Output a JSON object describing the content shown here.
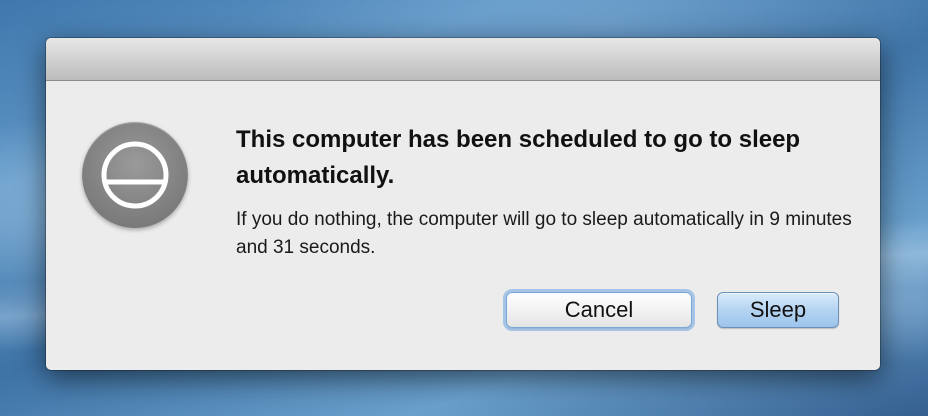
{
  "dialog": {
    "icon": "sleep-power-icon",
    "title": "This computer has been scheduled to go to sleep automatically.",
    "message": "If you do nothing, the computer will go to sleep automatically in 9 minutes and 31 seconds.",
    "buttons": {
      "cancel_label": "Cancel",
      "sleep_label": "Sleep"
    },
    "default_button": "Cancel"
  }
}
